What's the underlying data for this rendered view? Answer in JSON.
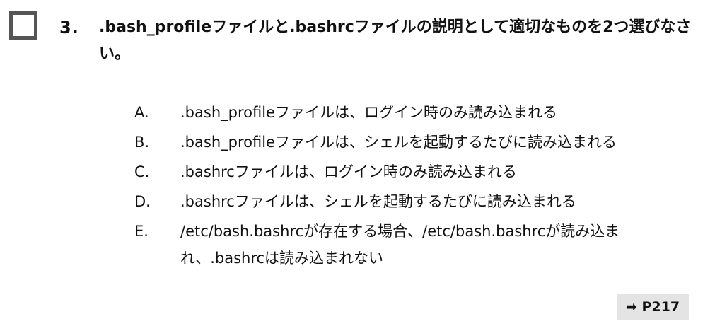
{
  "question": {
    "number": "3.",
    "text": ".bash_profileファイルと.bashrcファイルの説明として適切なものを2つ選びなさい。"
  },
  "choices": [
    {
      "letter": "A.",
      "text": ".bash_profileファイルは、ログイン時のみ読み込まれる"
    },
    {
      "letter": "B.",
      "text": ".bash_profileファイルは、シェルを起動するたびに読み込まれる"
    },
    {
      "letter": "C.",
      "text": ".bashrcファイルは、ログイン時のみ読み込まれる"
    },
    {
      "letter": "D.",
      "text": ".bashrcファイルは、シェルを起動するたびに読み込まれる"
    },
    {
      "letter": "E.",
      "text": "/etc/bash.bashrcが存在する場合、/etc/bash.bashrcが読み込まれ、.bashrcは読み込まれない"
    }
  ],
  "reference": {
    "arrow": "➡",
    "page": "P217"
  }
}
